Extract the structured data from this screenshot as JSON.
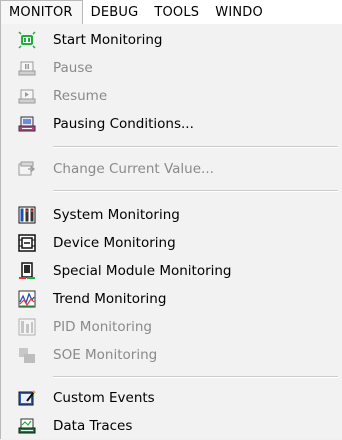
{
  "menubar": {
    "items": [
      "MONITOR",
      "DEBUG",
      "TOOLS",
      "WINDO"
    ]
  },
  "menu": {
    "items": [
      {
        "label": "Start Monitoring",
        "enabled": true,
        "icon": "start-monitoring-icon"
      },
      {
        "label": "Pause",
        "enabled": false,
        "icon": "pause-icon"
      },
      {
        "label": "Resume",
        "enabled": false,
        "icon": "resume-icon"
      },
      {
        "label": "Pausing Conditions...",
        "enabled": true,
        "icon": "pausing-conditions-icon"
      },
      {
        "label": "Change Current Value...",
        "enabled": false,
        "icon": "change-value-icon"
      },
      {
        "label": "System Monitoring",
        "enabled": true,
        "icon": "system-monitoring-icon"
      },
      {
        "label": "Device Monitoring",
        "enabled": true,
        "icon": "device-monitoring-icon"
      },
      {
        "label": "Special Module Monitoring",
        "enabled": true,
        "icon": "special-module-icon"
      },
      {
        "label": "Trend Monitoring",
        "enabled": true,
        "icon": "trend-monitoring-icon"
      },
      {
        "label": "PID Monitoring",
        "enabled": false,
        "icon": "pid-monitoring-icon"
      },
      {
        "label": "SOE Monitoring",
        "enabled": false,
        "icon": "soe-monitoring-icon"
      },
      {
        "label": "Custom Events",
        "enabled": true,
        "icon": "custom-events-icon"
      },
      {
        "label": "Data Traces",
        "enabled": true,
        "icon": "data-traces-icon"
      }
    ]
  },
  "colors": {
    "menu_bg": "#f2f2f2",
    "disabled_text": "#8a8a8a",
    "accent_green": "#1fae3a",
    "accent_blue": "#1e4fb3"
  }
}
